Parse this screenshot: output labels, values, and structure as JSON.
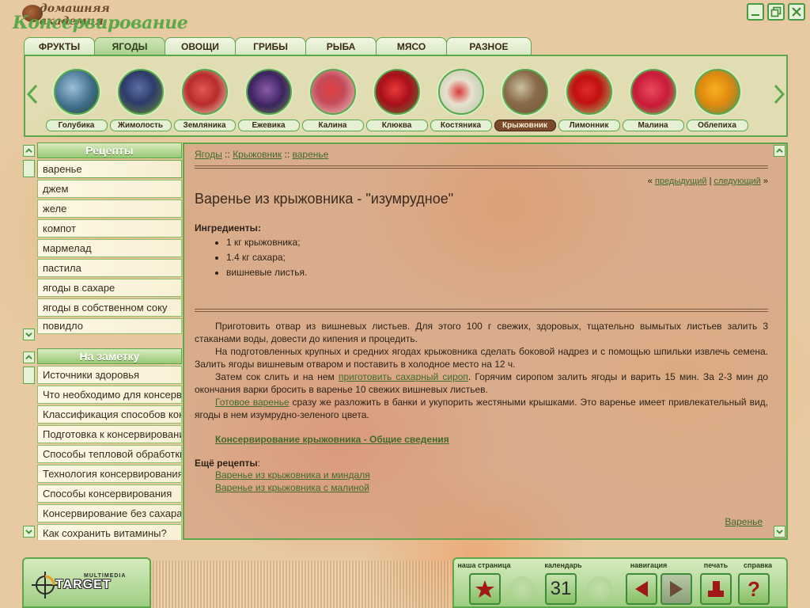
{
  "app": {
    "logo_small": "домашняя академия",
    "logo_big": "Консервирование"
  },
  "tabs": [
    {
      "label": "ФРУКТЫ"
    },
    {
      "label": "ЯГОДЫ"
    },
    {
      "label": "ОВОЩИ"
    },
    {
      "label": "ГРИБЫ"
    },
    {
      "label": "РЫБА"
    },
    {
      "label": "МЯСО"
    },
    {
      "label": "РАЗНОЕ"
    }
  ],
  "berries": [
    {
      "label": "Голубика"
    },
    {
      "label": "Жимолость"
    },
    {
      "label": "Земляника"
    },
    {
      "label": "Ежевика"
    },
    {
      "label": "Калина"
    },
    {
      "label": "Клюква"
    },
    {
      "label": "Костяника"
    },
    {
      "label": "Крыжовник"
    },
    {
      "label": "Лимонник"
    },
    {
      "label": "Малина"
    },
    {
      "label": "Облепиха"
    }
  ],
  "recipes": {
    "header": "Рецепты",
    "items": [
      "варенье",
      "джем",
      "желе",
      "компот",
      "мармелад",
      "пастила",
      "ягоды в сахаре",
      "ягоды в собственном соку",
      "повидло"
    ]
  },
  "notes": {
    "header": "На заметку",
    "items": [
      "Источники здоровья",
      "Что необходимо для консервирования",
      "Классификация способов консервирования",
      "Подготовка к консервированию",
      "Способы тепловой обработки",
      "Технология консервирования",
      "Способы консервирования",
      "Консервирование без сахара",
      "Как сохранить витамины?"
    ]
  },
  "breadcrumb": {
    "part1": "Ягоды",
    "sep": "::",
    "part2": "Крыжовник",
    "part3": "варенье"
  },
  "nav": {
    "prev": "предыдущий",
    "next": "следующий",
    "sep": "|",
    "left_quote": "«",
    "right_quote": "»"
  },
  "article": {
    "title": "Варенье из крыжовника - \"изумрудное\"",
    "ingredients_label": "Ингредиенты:",
    "ingredients": [
      "1 кг крыжовника;",
      "1.4 кг сахара;",
      "вишневые листья."
    ],
    "p1": "Приготовить отвар из вишневых листьев. Для этого 100 г свежих, здоровых, тщательно вымытых листьев залить 3 стаканами воды, довести до кипения и процедить.",
    "p2": "На подготовленных крупных и средних ягодах крыжовника сделать боковой надрез и с помощью шпильки извлечь семена. Залить ягоды вишневым отваром и поставить в холодное место на 12 ч.",
    "p3_a": "Затем сок слить и на нем ",
    "p3_link": "приготовить сахарный сироп",
    "p3_b": ". Горячим сиропом залить ягоды и варить 15 мин. За 2-3 мин до окончания варки бросить в варенье 10 свежих вишневых листьев.",
    "p4_link": "Готовое варенье",
    "p4_b": " сразу же разложить в банки и укупорить жестяными крышками. Это варенье имеет привлекательный вид, ягоды в нем изумрудно-зеленого цвета.",
    "general_link": "Консервирование крыжовника - Общие сведения",
    "more_label": "Ещё рецепты",
    "more_colon": ":",
    "more": [
      "Варенье из крыжовника и миндаля",
      "Варенье из крыжовника с малиной"
    ],
    "footer_link": "Варенье"
  },
  "brand": {
    "multimedia": "MULTIMEDIA",
    "name": "TARGET"
  },
  "toolbar": {
    "home": "наша страница",
    "calendar": "календарь",
    "calendar_day": "31",
    "navigation": "навигация",
    "print": "печать",
    "help": "справка",
    "help_glyph": "?"
  },
  "colors": {
    "accent": "#5aa84a",
    "link": "#3e6b2c",
    "active_berry": "#7b4a2a"
  }
}
